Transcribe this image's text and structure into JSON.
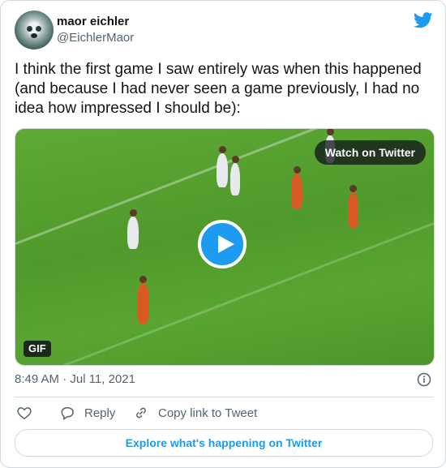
{
  "author": {
    "name": "maor eichler",
    "handle": "@EichlerMaor"
  },
  "tweet": {
    "text": "I think the first game I saw entirely was when this happened (and because I had never seen a game previously, I had no idea how impressed I should be):"
  },
  "media": {
    "watch_label": "Watch on Twitter",
    "badge": "GIF",
    "field_color": "#55a02f",
    "play_color": "#1d9bf0"
  },
  "meta": {
    "timestamp": "8:49 AM · Jul 11, 2021"
  },
  "actions": {
    "reply": "Reply",
    "copy_link": "Copy link to Tweet"
  },
  "footer": {
    "explore": "Explore what's happening on Twitter"
  },
  "colors": {
    "accent": "#1d9bf0",
    "muted": "#536471",
    "text": "#0f1419",
    "border": "#cfd9de"
  },
  "icons": [
    "twitter-logo-icon",
    "play-icon",
    "info-icon",
    "heart-icon",
    "reply-icon",
    "link-icon"
  ]
}
